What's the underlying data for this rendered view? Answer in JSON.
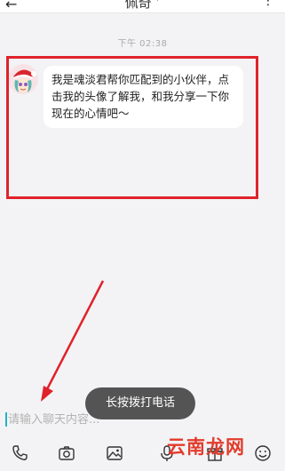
{
  "header": {
    "back_icon": "arrow-left-icon",
    "title": "佩奇 ’",
    "more_icon": "more-vertical-icon"
  },
  "chat": {
    "timestamp": "下午 02:38",
    "messages": [
      {
        "sender_avatar": "avatar-santa-hat",
        "text": "我是魂淡君帮你匹配到的小伙伴，点击我的头像了解我，和我分享一下你现在的心情吧～"
      }
    ]
  },
  "toast": {
    "text": "长按拨打电话"
  },
  "input": {
    "placeholder": "请输入聊天内容..."
  },
  "toolbar": {
    "icons": [
      "phone-icon",
      "camera-icon",
      "image-icon",
      "microphone-icon",
      "gift-icon",
      "emoji-icon"
    ]
  },
  "watermark": {
    "text": "云南龙网"
  },
  "colors": {
    "annotation_red": "#e0222b",
    "cursor_teal": "#21b3c1",
    "background": "#f3f3f5"
  }
}
